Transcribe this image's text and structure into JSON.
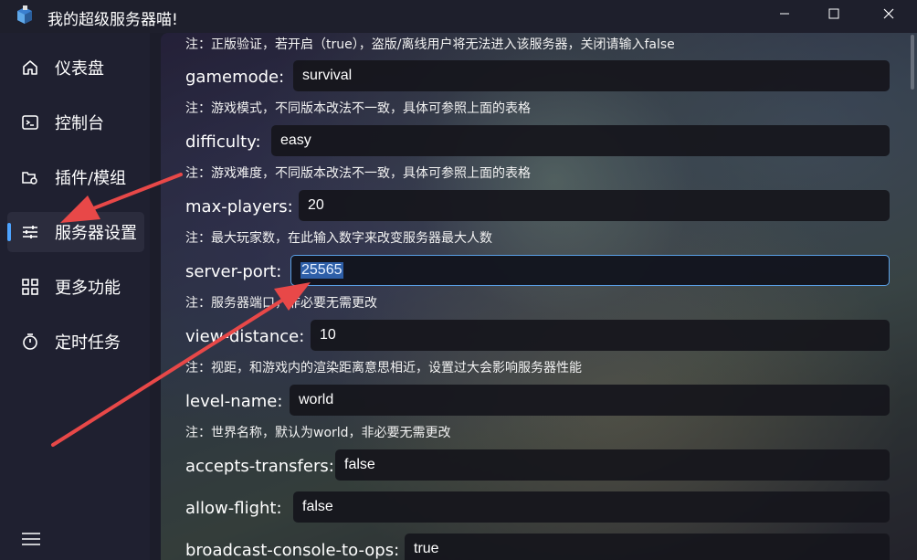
{
  "window": {
    "title": "我的超级服务器喵!",
    "minimize_icon": "minimize-icon",
    "maximize_icon": "maximize-icon",
    "close_icon": "close-icon"
  },
  "sidebar": {
    "items": [
      {
        "label": "仪表盘",
        "icon": "home-icon"
      },
      {
        "label": "控制台",
        "icon": "terminal-icon"
      },
      {
        "label": "插件/模组",
        "icon": "plugin-icon"
      },
      {
        "label": "服务器设置",
        "icon": "sliders-icon"
      },
      {
        "label": "更多功能",
        "icon": "grid-icon"
      },
      {
        "label": "定时任务",
        "icon": "timer-icon"
      }
    ],
    "active_index": 3,
    "menu_icon": "hamburger-icon"
  },
  "settings": {
    "top_note": "注：正版验证，若开启（true），盗版/离线用户将无法进入该服务器，关闭请输入false",
    "rows": [
      {
        "key": "gamemode:",
        "value": "survival",
        "note": "注：游戏模式，不同版本改法不一致，具体可参照上面的表格"
      },
      {
        "key": "difficulty:",
        "value": "easy",
        "note": "注：游戏难度，不同版本改法不一致，具体可参照上面的表格"
      },
      {
        "key": "max-players:",
        "value": "20",
        "note": "注：最大玩家数，在此输入数字来改变服务器最大人数"
      },
      {
        "key": "server-port:",
        "value": "25565",
        "note": "注：服务器端口，非必要无需更改"
      },
      {
        "key": "view-distance:",
        "value": "10",
        "note": "注：视距，和游戏内的渲染距离意思相近，设置过大会影响服务器性能"
      },
      {
        "key": "level-name:",
        "value": "world",
        "note": "注：世界名称，默认为world，非必要无需更改"
      },
      {
        "key": "accepts-transfers:",
        "value": "false",
        "note": ""
      },
      {
        "key": "allow-flight:",
        "value": "false",
        "note": ""
      },
      {
        "key": "broadcast-console-to-ops:",
        "value": "true",
        "note": ""
      }
    ],
    "focused_row": 3
  },
  "colors": {
    "accent": "#4da3ff",
    "arrow": "#e84848"
  }
}
